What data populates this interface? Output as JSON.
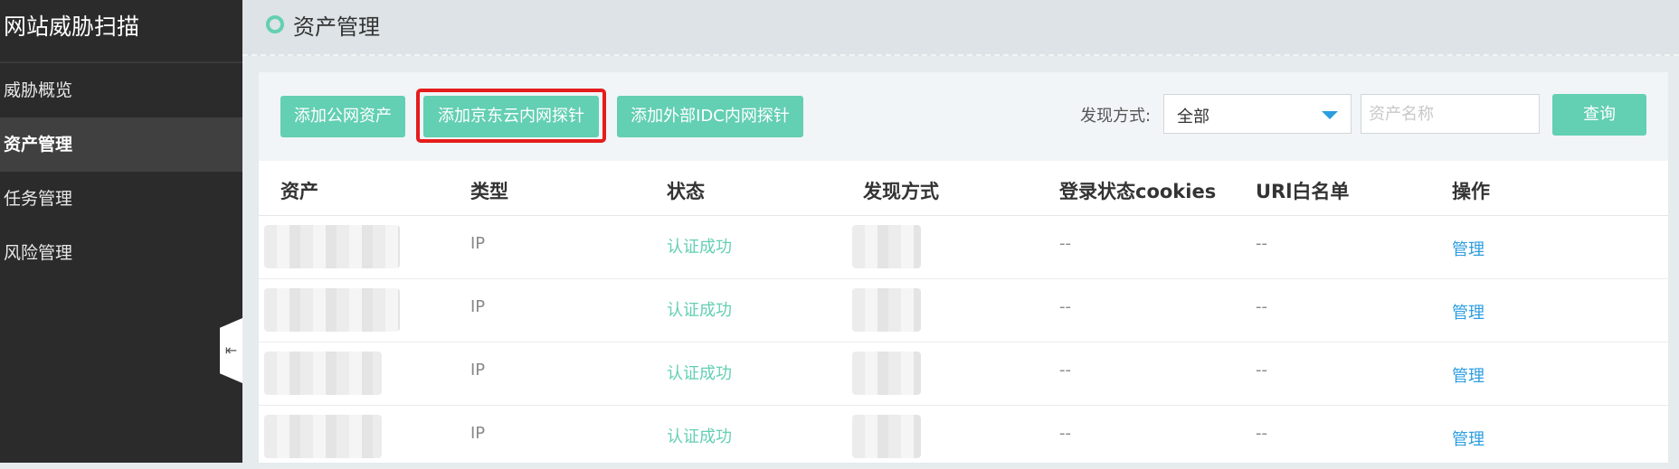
{
  "sidebar": {
    "title": "网站威胁扫描",
    "items": [
      {
        "label": "威胁概览"
      },
      {
        "label": "资产管理"
      },
      {
        "label": "任务管理"
      },
      {
        "label": "风险管理"
      }
    ],
    "collapse_glyph": "⇤"
  },
  "header": {
    "title": "资产管理"
  },
  "toolbar": {
    "add_public_label": "添加公网资产",
    "add_jdcloud_label": "添加京东云内网探针",
    "add_idc_label": "添加外部IDC内网探针",
    "filter_label": "发现方式:",
    "filter_value": "全部",
    "search_placeholder": "资产名称",
    "query_label": "查询"
  },
  "table": {
    "columns": [
      "资产",
      "类型",
      "状态",
      "发现方式",
      "登录状态cookies",
      "URl白名单",
      "操作"
    ],
    "rows": [
      {
        "type": "IP",
        "status": "认证成功",
        "cookies": "--",
        "whitelist": "--",
        "action": "管理"
      },
      {
        "type": "IP",
        "status": "认证成功",
        "cookies": "--",
        "whitelist": "--",
        "action": "管理"
      },
      {
        "type": "IP",
        "status": "认证成功",
        "cookies": "--",
        "whitelist": "--",
        "action": "管理"
      },
      {
        "type": "IP",
        "status": "认证成功",
        "cookies": "--",
        "whitelist": "--",
        "action": "管理"
      }
    ]
  },
  "colors": {
    "accent": "#63cfb3",
    "link": "#2c9de0",
    "highlight": "#e51c1c",
    "sidebar": "#2b2b2b"
  }
}
